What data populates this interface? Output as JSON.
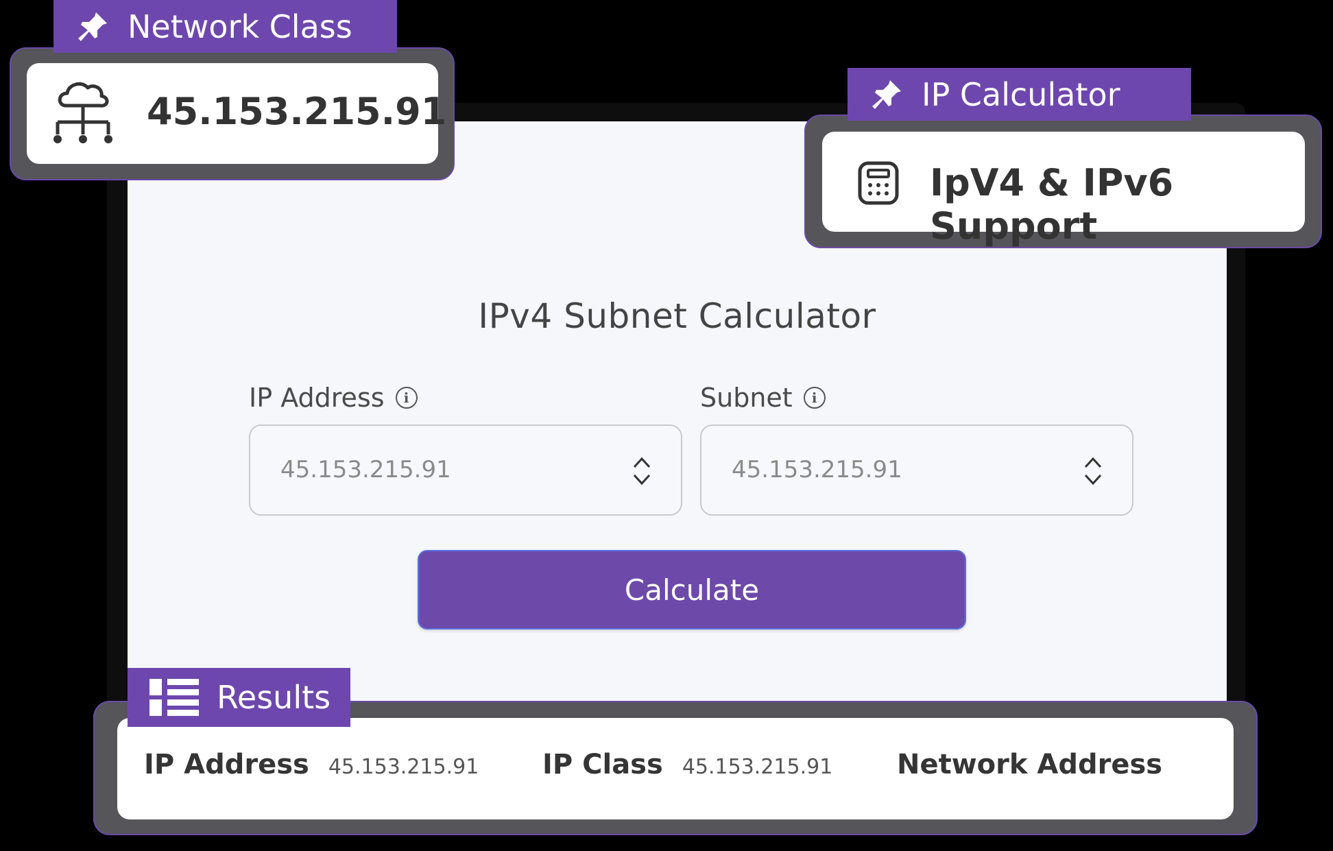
{
  "network_class": {
    "tag_label": "Network Class",
    "value": "45.153.215.91"
  },
  "ip_calculator": {
    "tag_label": "IP  Calculator",
    "value": "IpV4 & IPv6 Support"
  },
  "calculator": {
    "title": "IPv4 Subnet Calculator",
    "ip_label": "IP Address",
    "ip_value": "45.153.215.91",
    "subnet_label": "Subnet",
    "subnet_value": "45.153.215.91",
    "button_label": "Calculate"
  },
  "results": {
    "tag_label": "Results",
    "ip_address_label": "IP Address",
    "ip_address_value": "45.153.215.91",
    "ip_class_label": "IP Class",
    "ip_class_value": "45.153.215.91",
    "network_address_label": "Network Address"
  },
  "colors": {
    "accent": "#6d47ad",
    "background": "#000000",
    "card": "#f6f7fb"
  },
  "icons": [
    "pin-icon",
    "cloud-network-icon",
    "calculator-icon",
    "info-icon",
    "stepper-icon",
    "list-icon"
  ]
}
